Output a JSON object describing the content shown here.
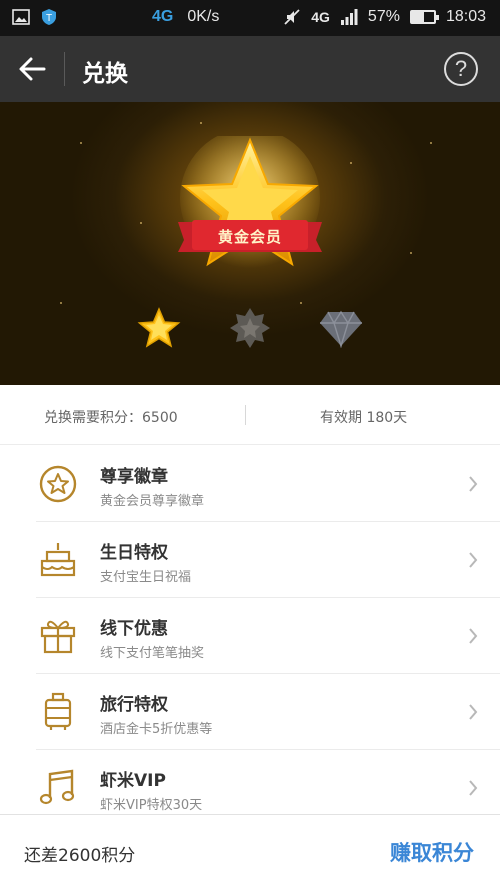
{
  "status_bar": {
    "network_gen": "4G",
    "speed": "0K/s",
    "signal_gen": "4G",
    "battery_percent": "57%",
    "battery_level": 0.57,
    "time": "18:03"
  },
  "app_bar": {
    "title": "兑换",
    "help_label": "?"
  },
  "hero": {
    "medal_label": "黄金会员"
  },
  "info": {
    "points_required": "兑换需要积分：6500",
    "validity": "有效期 180天"
  },
  "benefits": [
    {
      "title": "尊享徽章",
      "subtitle": "黄金会员尊享徽章",
      "icon": "star-badge-icon"
    },
    {
      "title": "生日特权",
      "subtitle": "支付宝生日祝福",
      "icon": "cake-icon"
    },
    {
      "title": "线下优惠",
      "subtitle": "线下支付笔笔抽奖",
      "icon": "gift-icon"
    },
    {
      "title": "旅行特权",
      "subtitle": "酒店金卡5折优惠等",
      "icon": "luggage-icon"
    },
    {
      "title": "虾米VIP",
      "subtitle": "虾米VIP特权30天",
      "icon": "music-note-icon"
    }
  ],
  "bottom": {
    "remaining_text": "还差2600积分",
    "earn_label": "赚取积分"
  },
  "colors": {
    "accent_gold": "#b5862c",
    "link_blue": "#3a86d6",
    "app_bar": "#333333"
  }
}
